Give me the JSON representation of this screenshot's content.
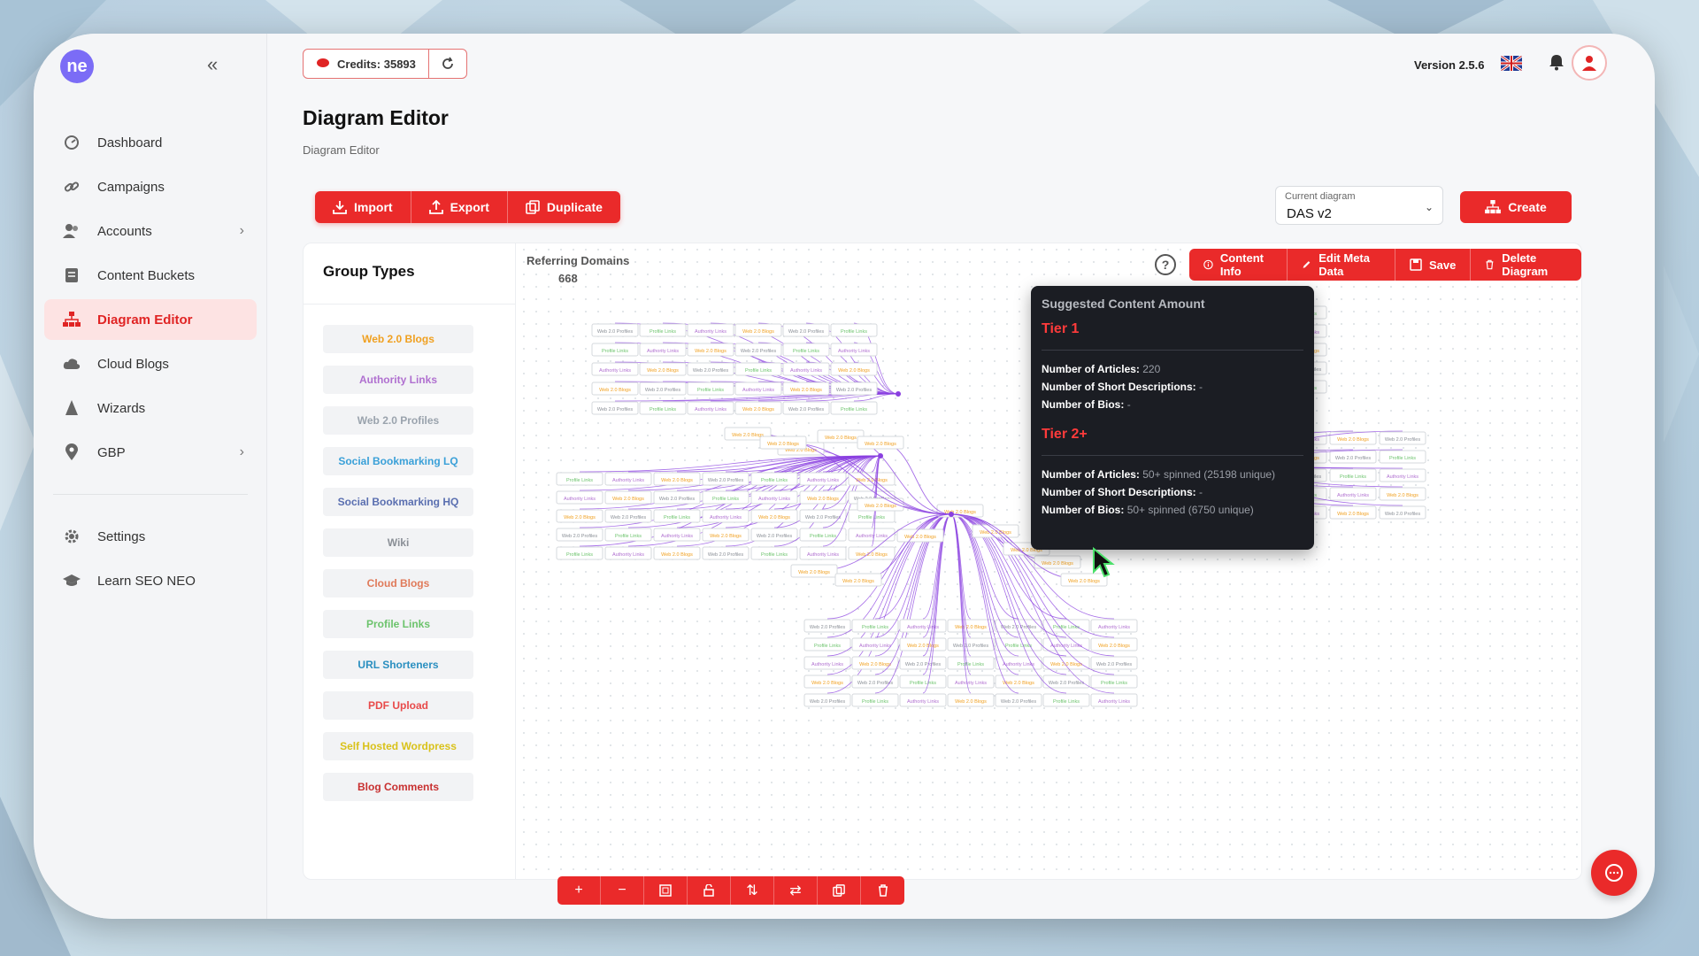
{
  "topbar": {
    "credits_label": "Credits: 35893",
    "version": "Version 2.5.6"
  },
  "sidebar": {
    "items": [
      {
        "label": "Dashboard",
        "icon": "dashboard-icon"
      },
      {
        "label": "Campaigns",
        "icon": "link-icon"
      },
      {
        "label": "Accounts",
        "icon": "users-icon"
      },
      {
        "label": "Content Buckets",
        "icon": "document-icon"
      },
      {
        "label": "Diagram Editor",
        "icon": "sitemap-icon"
      },
      {
        "label": "Cloud Blogs",
        "icon": "cloud-icon"
      },
      {
        "label": "Wizards",
        "icon": "wizard-icon"
      },
      {
        "label": "GBP",
        "icon": "map-pin-icon"
      },
      {
        "label": "Settings",
        "icon": "gear-icon"
      },
      {
        "label": "Learn SEO NEO",
        "icon": "graduation-cap-icon"
      }
    ]
  },
  "page": {
    "title": "Diagram Editor",
    "breadcrumb": "Diagram Editor"
  },
  "toolbar": {
    "import_label": "Import",
    "export_label": "Export",
    "duplicate_label": "Duplicate",
    "create_label": "Create"
  },
  "diagram_select": {
    "label": "Current diagram",
    "value": "DAS v2"
  },
  "group_types": {
    "title": "Group Types",
    "items": [
      {
        "label": "Web 2.0 Blogs",
        "color": "#f0a020"
      },
      {
        "label": "Authority Links",
        "color": "#b070d0"
      },
      {
        "label": "Web 2.0 Profiles",
        "color": "#9aa3ad"
      },
      {
        "label": "Social Bookmarking LQ",
        "color": "#3aa0d8"
      },
      {
        "label": "Social Bookmarking HQ",
        "color": "#5a6fb0"
      },
      {
        "label": "Wiki",
        "color": "#8a8f96"
      },
      {
        "label": "Cloud Blogs",
        "color": "#e07a5a"
      },
      {
        "label": "Profile Links",
        "color": "#6cc36c"
      },
      {
        "label": "URL Shorteners",
        "color": "#2a8fc0"
      },
      {
        "label": "PDF Upload",
        "color": "#e84a4a"
      },
      {
        "label": "Self Hosted Wordpress",
        "color": "#d9c21a"
      },
      {
        "label": "Blog Comments",
        "color": "#c83030"
      }
    ]
  },
  "canvas": {
    "ref_label": "Referring Domains",
    "ref_value": "668"
  },
  "actions": {
    "content_info": "Content Info",
    "edit_meta": "Edit Meta Data",
    "save": "Save",
    "delete": "Delete Diagram"
  },
  "tooltip": {
    "title": "Suggested Content Amount",
    "tier1": {
      "name": "Tier 1",
      "articles_label": "Number of Articles:",
      "articles_value": "220",
      "short_label": "Number of Short Descriptions:",
      "short_value": "-",
      "bios_label": "Number of Bios:",
      "bios_value": "-"
    },
    "tier2": {
      "name": "Tier 2+",
      "articles_label": "Number of Articles:",
      "articles_value": "50+ spinned (25198 unique)",
      "short_label": "Number of Short Descriptions:",
      "short_value": "-",
      "bios_label": "Number of Bios:",
      "bios_value": "50+ spinned (6750 unique)"
    }
  },
  "node_labels": {
    "web20_profiles": "Web 2.0 Profiles",
    "profile_links": "Profile Links",
    "authority_links": "Authority Links",
    "web20_blogs": "Web 2.0 Blogs"
  },
  "colors": {
    "accent": "#ea2a2a",
    "edge": "#8a3fe0"
  }
}
